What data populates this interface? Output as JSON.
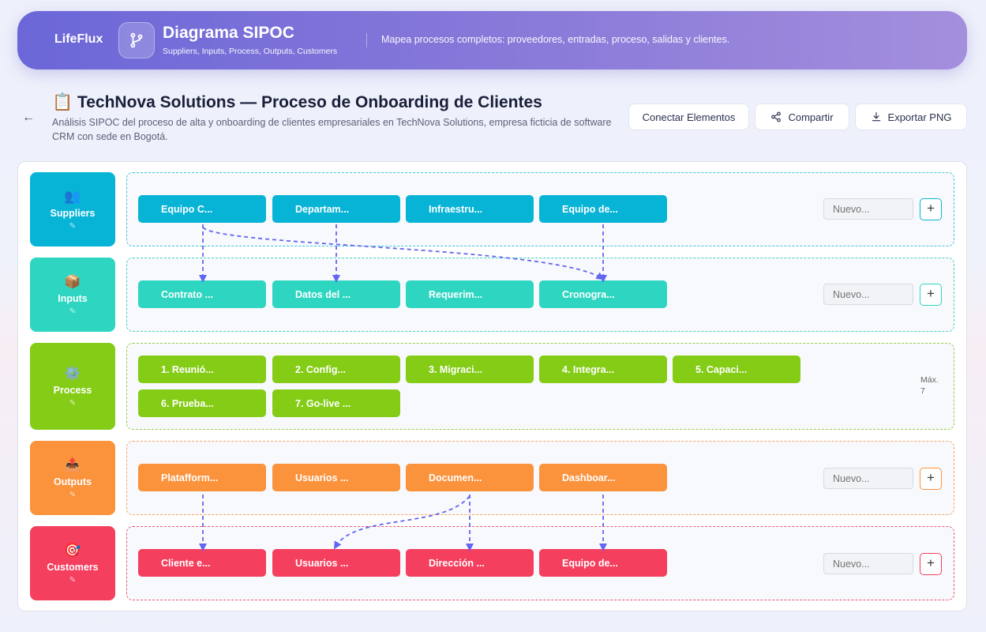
{
  "header": {
    "brand": "LifeFlux",
    "app_title": "Diagrama SIPOC",
    "app_subtitle": "Suppliers, Inputs, Process, Outputs, Customers",
    "tagline": "Mapea procesos completos: proveedores, entradas, proceso, salidas y clientes."
  },
  "document": {
    "title": "📋 TechNova Solutions — Proceso de Onboarding de Clientes",
    "description": "Análisis SIPOC del proceso de alta y onboarding de clientes empresariales en TechNova Solutions, empresa ficticia de software CRM con sede en Bogotá."
  },
  "toolbar": {
    "connect_label": "Conectar Elementos",
    "share_label": "Compartir",
    "export_label": "Exportar PNG"
  },
  "colors": {
    "suppliers": "#08b4d6",
    "inputs": "#2ed6c1",
    "process": "#84cc16",
    "outputs": "#fb923c",
    "customers": "#f43f5e",
    "connector": "#6366f1"
  },
  "lanes": {
    "suppliers": {
      "name": "Suppliers",
      "icon": "people-icon",
      "items": [
        "Equipo C...",
        "Departam...",
        "Infraestru...",
        "Equipo de..."
      ],
      "placeholder": "Nuevo..."
    },
    "inputs": {
      "name": "Inputs",
      "icon": "package-icon",
      "items": [
        "Contrato ...",
        "Datos del ...",
        "Requerim...",
        "Cronogra..."
      ],
      "placeholder": "Nuevo..."
    },
    "process": {
      "name": "Process",
      "icon": "gear-icon",
      "items": [
        "1. Reunió...",
        "2. Config...",
        "3. Migraci...",
        "4. Integra...",
        "5. Capaci...",
        "6. Prueba...",
        "7. Go-live ..."
      ],
      "max_note": "Máx. 7"
    },
    "outputs": {
      "name": "Outputs",
      "icon": "outbox-icon",
      "items": [
        "Platafform...",
        "Usuarios ...",
        "Documen...",
        "Dashboar..."
      ],
      "placeholder": "Nuevo..."
    },
    "customers": {
      "name": "Customers",
      "icon": "target-icon",
      "items": [
        "Cliente e...",
        "Usuarios ...",
        "Dirección ...",
        "Equipo de..."
      ],
      "placeholder": "Nuevo..."
    }
  }
}
